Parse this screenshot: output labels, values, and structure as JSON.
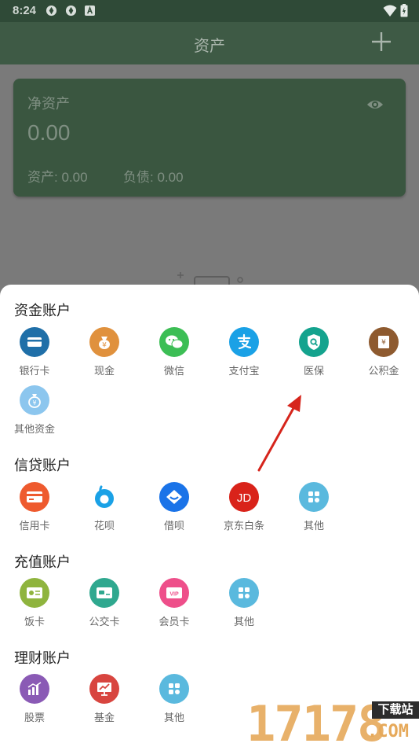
{
  "status": {
    "time": "8:24"
  },
  "appbar": {
    "title": "资产"
  },
  "card": {
    "label": "净资产",
    "amount": "0.00",
    "assets": "资产: 0.00",
    "liabilities": "负债: 0.00"
  },
  "sections": [
    {
      "title": "资金账户",
      "items": [
        {
          "label": "银行卡",
          "icon": "bank-card-icon",
          "color": "#1f6fa8"
        },
        {
          "label": "现金",
          "icon": "cash-bag-icon",
          "color": "#e0913d"
        },
        {
          "label": "微信",
          "icon": "wechat-icon",
          "color": "#3cbe55"
        },
        {
          "label": "支付宝",
          "icon": "alipay-icon",
          "color": "#1aa1e6"
        },
        {
          "label": "医保",
          "icon": "medical-insurance-icon",
          "color": "#14a38e"
        },
        {
          "label": "公积金",
          "icon": "housing-fund-icon",
          "color": "#8e5a2f"
        },
        {
          "label": "其他资金",
          "icon": "money-bag-icon",
          "color": "#8cc6ee"
        }
      ]
    },
    {
      "title": "信贷账户",
      "items": [
        {
          "label": "信用卡",
          "icon": "credit-card-icon",
          "color": "#ee5a2e"
        },
        {
          "label": "花呗",
          "icon": "huabei-icon",
          "color": "#ffffff"
        },
        {
          "label": "借呗",
          "icon": "jiebei-icon",
          "color": "#1a73e8"
        },
        {
          "label": "京东白条",
          "icon": "jd-icon",
          "color": "#d9231a"
        },
        {
          "label": "其他",
          "icon": "grid-icon",
          "color": "#5ab9de"
        }
      ]
    },
    {
      "title": "充值账户",
      "items": [
        {
          "label": "饭卡",
          "icon": "meal-card-icon",
          "color": "#8fb43e"
        },
        {
          "label": "公交卡",
          "icon": "bus-card-icon",
          "color": "#2fa88f"
        },
        {
          "label": "会员卡",
          "icon": "vip-card-icon",
          "color": "#ee4f8a"
        },
        {
          "label": "其他",
          "icon": "grid-icon",
          "color": "#5ab9de"
        }
      ]
    },
    {
      "title": "理财账户",
      "items": [
        {
          "label": "股票",
          "icon": "stock-chart-icon",
          "color": "#8a5ab5"
        },
        {
          "label": "基金",
          "icon": "fund-chart-icon",
          "color": "#d8453f"
        },
        {
          "label": "其他",
          "icon": "grid-icon",
          "color": "#5ab9de"
        }
      ]
    }
  ],
  "watermark": {
    "digits": "17178",
    "tag": "下载站",
    "domain": ".COM"
  }
}
